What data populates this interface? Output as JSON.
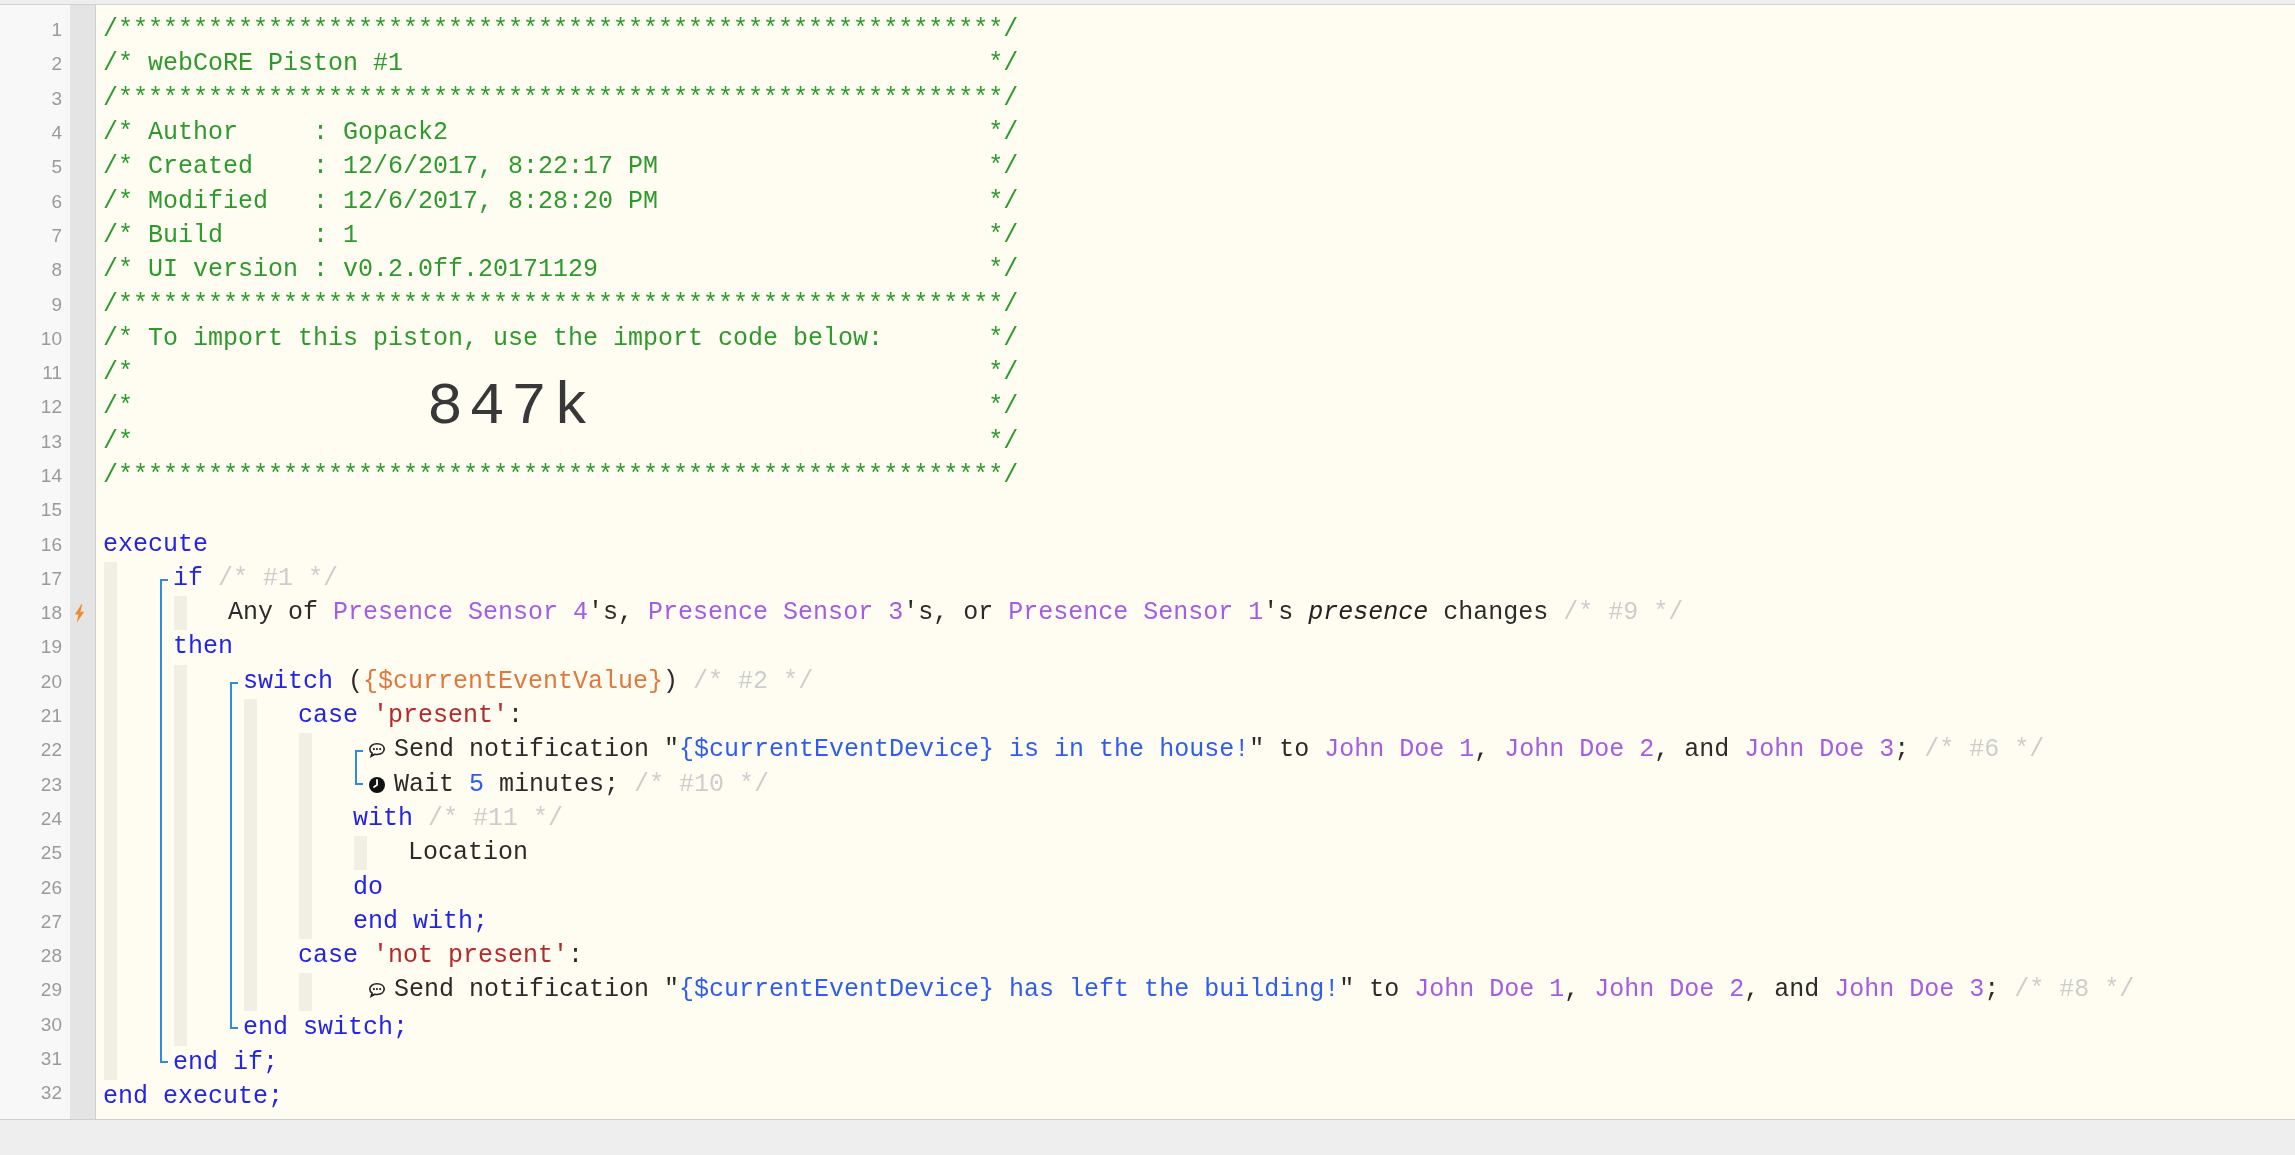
{
  "piston": {
    "code": [
      {
        "kind": "line",
        "number": "1",
        "trigger": false,
        "tokens": [
          {
            "kind": "comment",
            "text": "/***********************************************************/"
          }
        ]
      },
      {
        "kind": "line",
        "number": "2",
        "trigger": false,
        "tokens": [
          {
            "kind": "comment",
            "text": "/* webCoRE Piston #1"
          },
          {
            "kind": "close",
            "text": "*/"
          }
        ]
      },
      {
        "kind": "line",
        "number": "3",
        "trigger": false,
        "tokens": [
          {
            "kind": "comment",
            "text": "/***********************************************************/"
          }
        ]
      },
      {
        "kind": "line",
        "number": "4",
        "trigger": false,
        "tokens": [
          {
            "kind": "comment",
            "text": "/* Author     : Gopack2"
          },
          {
            "kind": "close",
            "text": "*/"
          }
        ]
      },
      {
        "kind": "line",
        "number": "5",
        "trigger": false,
        "tokens": [
          {
            "kind": "comment",
            "text": "/* Created    : 12/6/2017, 8:22:17 PM"
          },
          {
            "kind": "close",
            "text": "*/"
          }
        ]
      },
      {
        "kind": "line",
        "number": "6",
        "trigger": false,
        "tokens": [
          {
            "kind": "comment",
            "text": "/* Modified   : 12/6/2017, 8:28:20 PM"
          },
          {
            "kind": "close",
            "text": "*/"
          }
        ]
      },
      {
        "kind": "line",
        "number": "7",
        "trigger": false,
        "tokens": [
          {
            "kind": "comment",
            "text": "/* Build      : 1"
          },
          {
            "kind": "close",
            "text": "*/"
          }
        ]
      },
      {
        "kind": "line",
        "number": "8",
        "trigger": false,
        "tokens": [
          {
            "kind": "comment",
            "text": "/* UI version : v0.2.0ff.20171129"
          },
          {
            "kind": "close",
            "text": "*/"
          }
        ]
      },
      {
        "kind": "line",
        "number": "9",
        "trigger": false,
        "tokens": [
          {
            "kind": "comment",
            "text": "/***********************************************************/"
          }
        ]
      },
      {
        "kind": "line",
        "number": "10",
        "trigger": false,
        "tokens": [
          {
            "kind": "comment",
            "text": "/* To import this piston, use the import code below:"
          },
          {
            "kind": "close",
            "text": "*/"
          }
        ]
      },
      {
        "kind": "line",
        "number": "11",
        "trigger": false,
        "tokens": [
          {
            "kind": "comment",
            "text": "/*"
          },
          {
            "kind": "close",
            "text": "*/"
          }
        ]
      },
      {
        "kind": "line",
        "number": "12",
        "trigger": false,
        "tokens": [
          {
            "kind": "comment",
            "text": "/*"
          },
          {
            "kind": "code",
            "text": "847k"
          },
          {
            "kind": "close",
            "text": "*/"
          }
        ]
      },
      {
        "kind": "line",
        "number": "13",
        "trigger": false,
        "tokens": [
          {
            "kind": "comment",
            "text": "/*"
          },
          {
            "kind": "close",
            "text": "*/"
          }
        ]
      },
      {
        "kind": "line",
        "number": "14",
        "trigger": false,
        "tokens": [
          {
            "kind": "comment",
            "text": "/***********************************************************/"
          }
        ]
      },
      {
        "kind": "line",
        "number": "15",
        "trigger": false
      },
      {
        "kind": "line",
        "number": "16",
        "trigger": false,
        "tokens": [
          {
            "kind": "keyword",
            "text": "execute"
          }
        ],
        "children": [
          {
            "kind": "group",
            "bracketed": true,
            "items": [
              {
                "kind": "line",
                "number": "17",
                "trigger": false,
                "tokens": [
                  {
                    "kind": "keyword",
                    "text": "if"
                  },
                  {
                    "kind": "muted",
                    "text": " /* #1 */"
                  }
                ],
                "children": [
                  {
                    "kind": "line",
                    "number": "18",
                    "trigger": true,
                    "tokens": [
                      {
                        "kind": "plain",
                        "text": "Any of "
                      },
                      {
                        "kind": "device",
                        "text": "Presence Sensor 4"
                      },
                      {
                        "kind": "plain",
                        "text": "'s, "
                      },
                      {
                        "kind": "device",
                        "text": "Presence Sensor 3"
                      },
                      {
                        "kind": "plain",
                        "text": "'s, or "
                      },
                      {
                        "kind": "device",
                        "text": "Presence Sensor 1"
                      },
                      {
                        "kind": "plain",
                        "text": "'s "
                      },
                      {
                        "kind": "attribute",
                        "text": "presence"
                      },
                      {
                        "kind": "plain",
                        "text": " changes "
                      },
                      {
                        "kind": "muted",
                        "text": "/* #9 */"
                      }
                    ]
                  }
                ]
              },
              {
                "kind": "line",
                "number": "19",
                "trigger": false,
                "tokens": [
                  {
                    "kind": "keyword",
                    "text": "then"
                  }
                ],
                "children": [
                  {
                    "kind": "group",
                    "bracketed": true,
                    "items": [
                      {
                        "kind": "line",
                        "number": "20",
                        "trigger": false,
                        "tokens": [
                          {
                            "kind": "keyword",
                            "text": "switch"
                          },
                          {
                            "kind": "plain",
                            "text": " ("
                          },
                          {
                            "kind": "variable",
                            "text": "{$currentEventValue}"
                          },
                          {
                            "kind": "plain",
                            "text": ") "
                          },
                          {
                            "kind": "muted",
                            "text": "/* #2 */"
                          }
                        ],
                        "children": [
                          {
                            "kind": "line",
                            "number": "21",
                            "trigger": false,
                            "tokens": [
                              {
                                "kind": "keyword",
                                "text": "case "
                              },
                              {
                                "kind": "literal",
                                "text": "'present'"
                              },
                              {
                                "kind": "plain",
                                "text": ":"
                              }
                            ],
                            "children": [
                              {
                                "kind": "group",
                                "bracketed": true,
                                "items": [
                                  {
                                    "kind": "notify",
                                    "number": "22",
                                    "trigger": false,
                                    "tokens": [
                                      {
                                        "kind": "plain",
                                        "text": "Send notification \""
                                      },
                                      {
                                        "kind": "expression",
                                        "text": "{$currentEventDevice} is in the house!"
                                      },
                                      {
                                        "kind": "plain",
                                        "text": "\" to "
                                      },
                                      {
                                        "kind": "device",
                                        "text": "John Doe 1"
                                      },
                                      {
                                        "kind": "plain",
                                        "text": ", "
                                      },
                                      {
                                        "kind": "device",
                                        "text": "John Doe 2"
                                      },
                                      {
                                        "kind": "plain",
                                        "text": ", and "
                                      },
                                      {
                                        "kind": "device",
                                        "text": "John Doe 3"
                                      },
                                      {
                                        "kind": "plain",
                                        "text": "; "
                                      },
                                      {
                                        "kind": "muted",
                                        "text": "/* #6 */"
                                      }
                                    ]
                                  },
                                  {
                                    "kind": "wait",
                                    "number": "23",
                                    "trigger": false,
                                    "tokens": [
                                      {
                                        "kind": "plain",
                                        "text": "Wait "
                                      },
                                      {
                                        "kind": "number",
                                        "text": "5"
                                      },
                                      {
                                        "kind": "plain",
                                        "text": " minutes; "
                                      },
                                      {
                                        "kind": "muted",
                                        "text": "/* #10 */"
                                      }
                                    ]
                                  }
                                ]
                              },
                              {
                                "kind": "line",
                                "number": "24",
                                "trigger": false,
                                "tokens": [
                                  {
                                    "kind": "keyword",
                                    "text": "with"
                                  },
                                  {
                                    "kind": "muted",
                                    "text": " /* #11 */"
                                  }
                                ],
                                "children": [
                                  {
                                    "kind": "line",
                                    "number": "25",
                                    "trigger": false,
                                    "tokens": [
                                      {
                                        "kind": "plain",
                                        "text": "Location"
                                      }
                                    ]
                                  }
                                ]
                              },
                              {
                                "kind": "line",
                                "number": "26",
                                "trigger": false,
                                "tokens": [
                                  {
                                    "kind": "keyword",
                                    "text": "do"
                                  }
                                ]
                              },
                              {
                                "kind": "line",
                                "number": "27",
                                "trigger": false,
                                "tokens": [
                                  {
                                    "kind": "keyword",
                                    "text": "end with;"
                                  }
                                ]
                              }
                            ]
                          },
                          {
                            "kind": "line",
                            "number": "28",
                            "trigger": false,
                            "tokens": [
                              {
                                "kind": "keyword",
                                "text": "case "
                              },
                              {
                                "kind": "literal",
                                "text": "'not present'"
                              },
                              {
                                "kind": "plain",
                                "text": ":"
                              }
                            ],
                            "children": [
                              {
                                "kind": "group",
                                "bracketed": false,
                                "items": [
                                  {
                                    "kind": "notify",
                                    "number": "29",
                                    "trigger": false,
                                    "tokens": [
                                      {
                                        "kind": "plain",
                                        "text": "Send notification \""
                                      },
                                      {
                                        "kind": "expression",
                                        "text": "{$currentEventDevice} has left the building!"
                                      },
                                      {
                                        "kind": "plain",
                                        "text": "\" to "
                                      },
                                      {
                                        "kind": "device",
                                        "text": "John Doe 1"
                                      },
                                      {
                                        "kind": "plain",
                                        "text": ", "
                                      },
                                      {
                                        "kind": "device",
                                        "text": "John Doe 2"
                                      },
                                      {
                                        "kind": "plain",
                                        "text": ", and "
                                      },
                                      {
                                        "kind": "device",
                                        "text": "John Doe 3"
                                      },
                                      {
                                        "kind": "plain",
                                        "text": "; "
                                      },
                                      {
                                        "kind": "muted",
                                        "text": "/* #8 */"
                                      }
                                    ]
                                  }
                                ]
                              }
                            ]
                          }
                        ]
                      },
                      {
                        "kind": "line",
                        "number": "30",
                        "trigger": false,
                        "tokens": [
                          {
                            "kind": "keyword",
                            "text": "end switch;"
                          }
                        ]
                      }
                    ]
                  }
                ]
              },
              {
                "kind": "line",
                "number": "31",
                "trigger": false,
                "tokens": [
                  {
                    "kind": "keyword",
                    "text": "end if;"
                  }
                ]
              }
            ]
          }
        ]
      },
      {
        "kind": "line",
        "number": "32",
        "trigger": false,
        "tokens": [
          {
            "kind": "keyword",
            "text": "end execute;"
          }
        ]
      }
    ]
  }
}
